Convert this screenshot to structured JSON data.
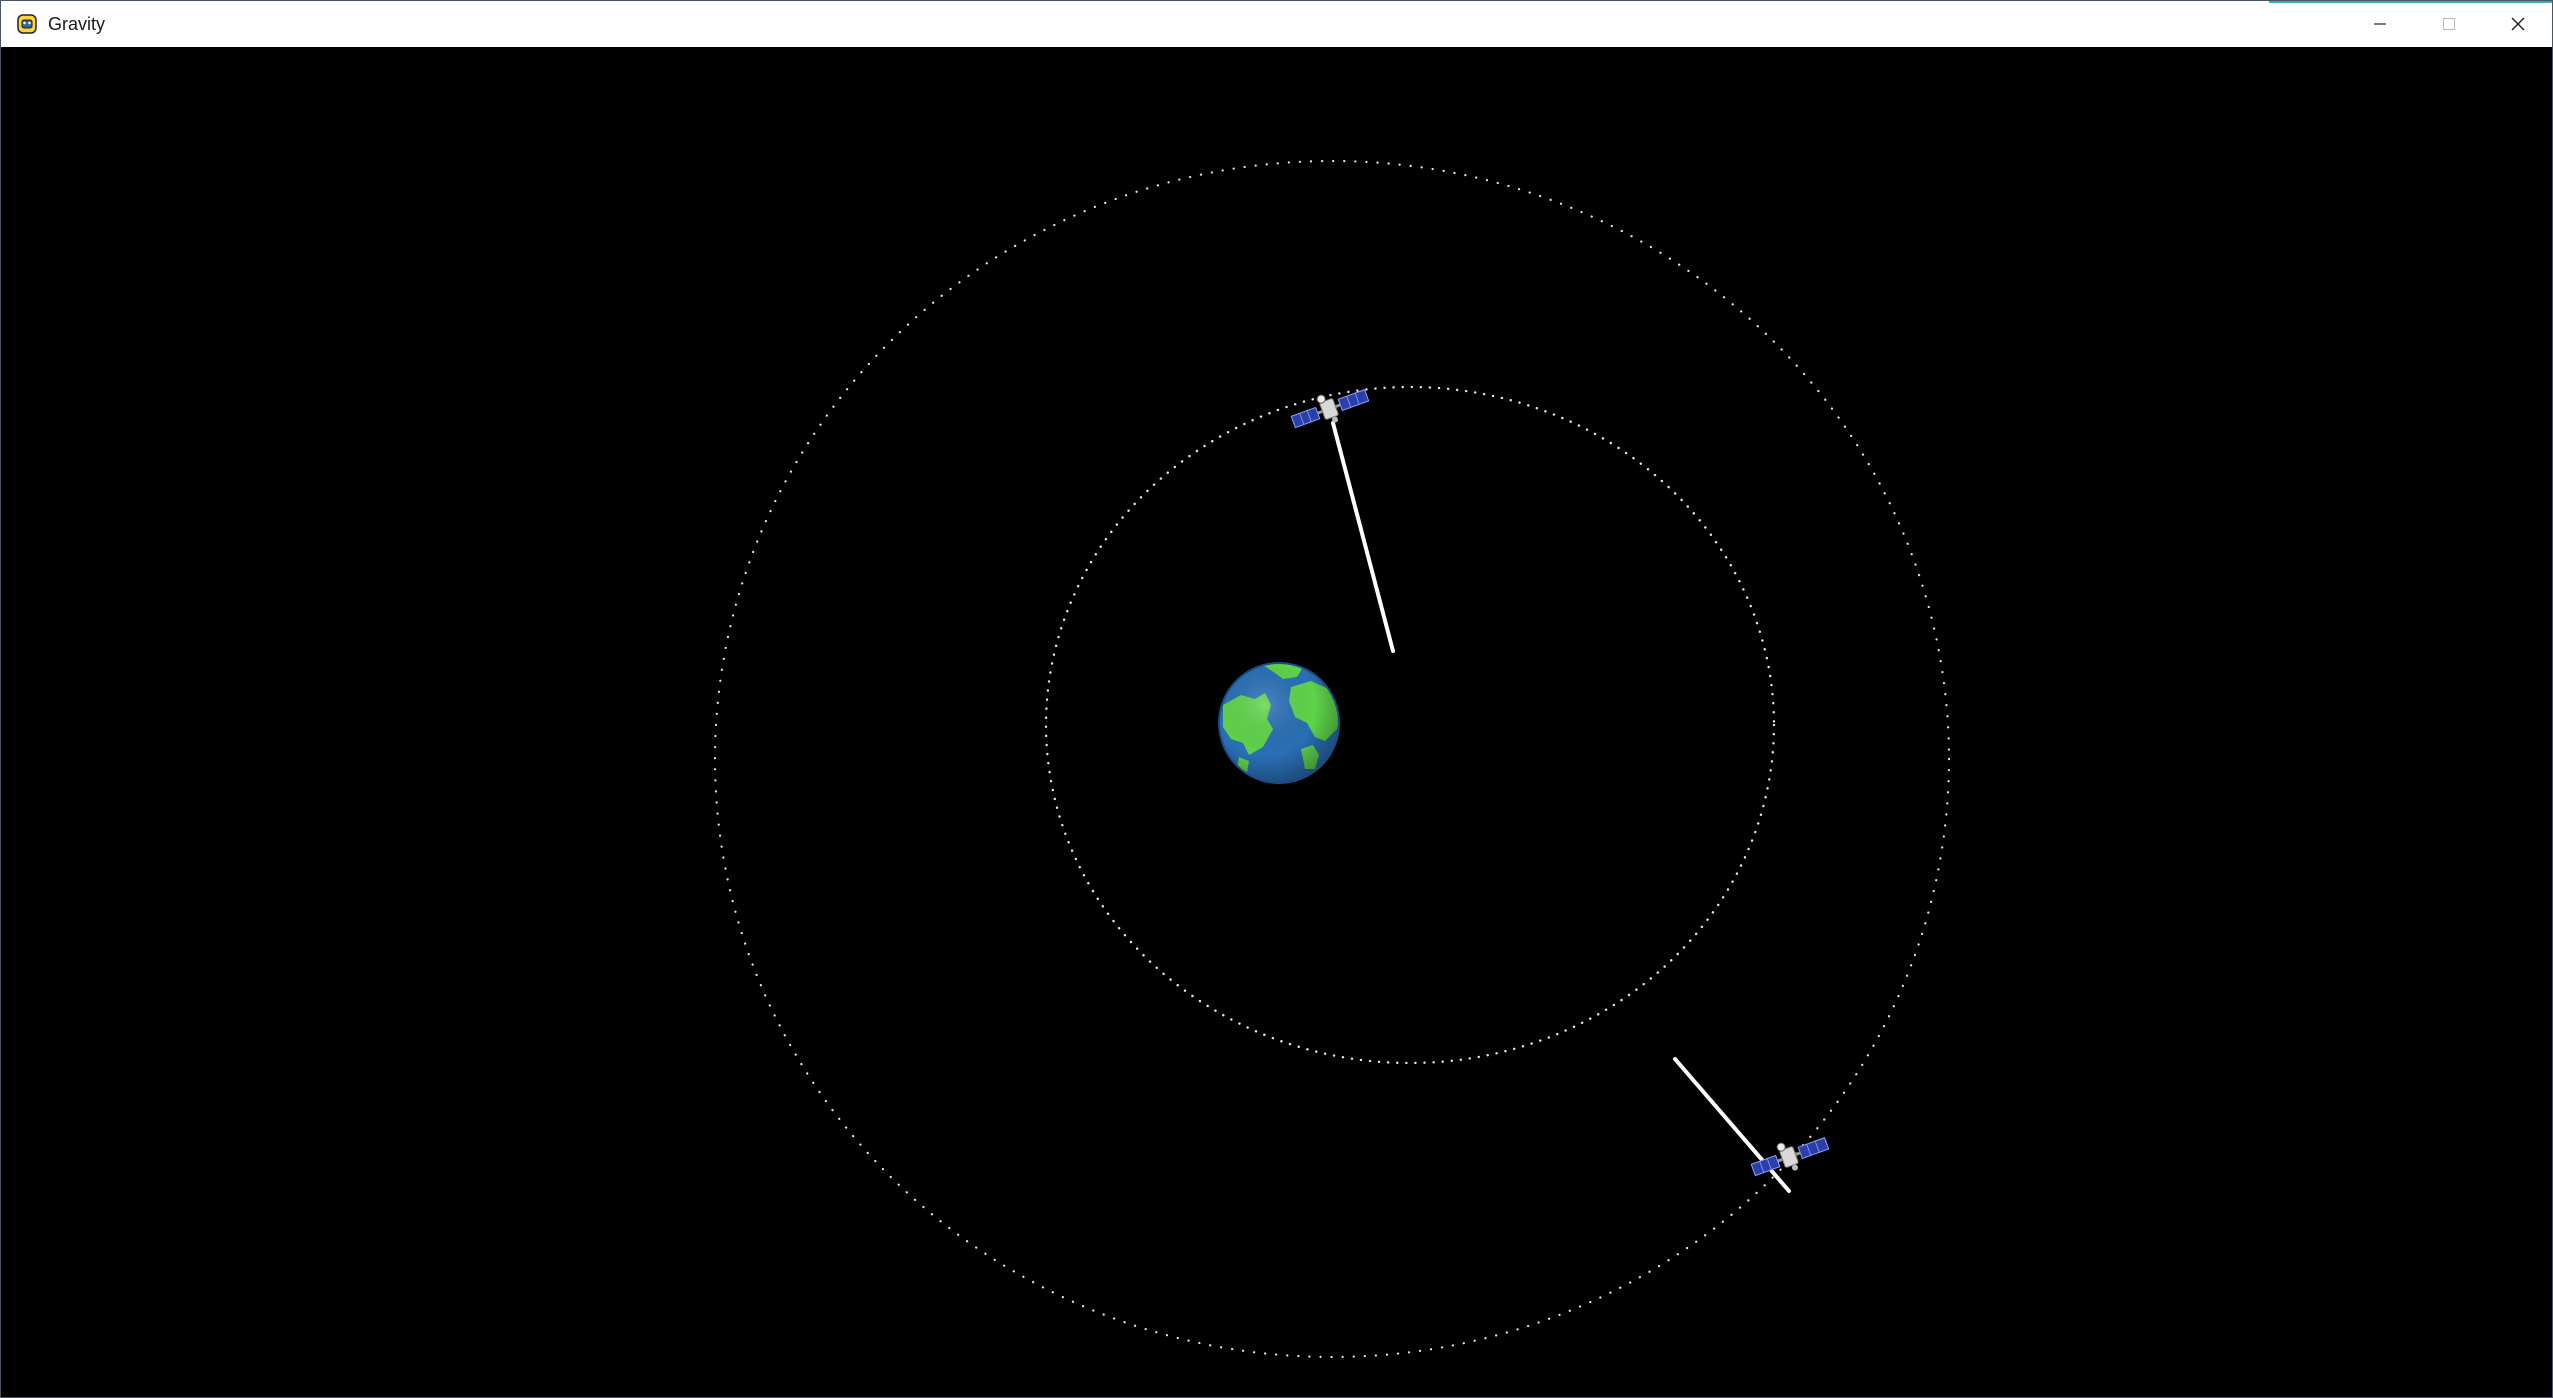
{
  "window": {
    "title": "Gravity",
    "icon": "python-icon",
    "controls": [
      "minimize-icon",
      "maximize-icon",
      "close-icon"
    ],
    "maximize_enabled": false
  },
  "scene": {
    "background": "#000000",
    "orbit_color": "#ffffff",
    "vector_color": "#ffffff",
    "planet": {
      "name": "earth",
      "ocean": "#2a6fb5",
      "land": "#5fd34a"
    },
    "satellites": [
      {
        "name": "satellite-1",
        "orbit": "inner"
      },
      {
        "name": "satellite-2",
        "orbit": "outer"
      }
    ]
  }
}
